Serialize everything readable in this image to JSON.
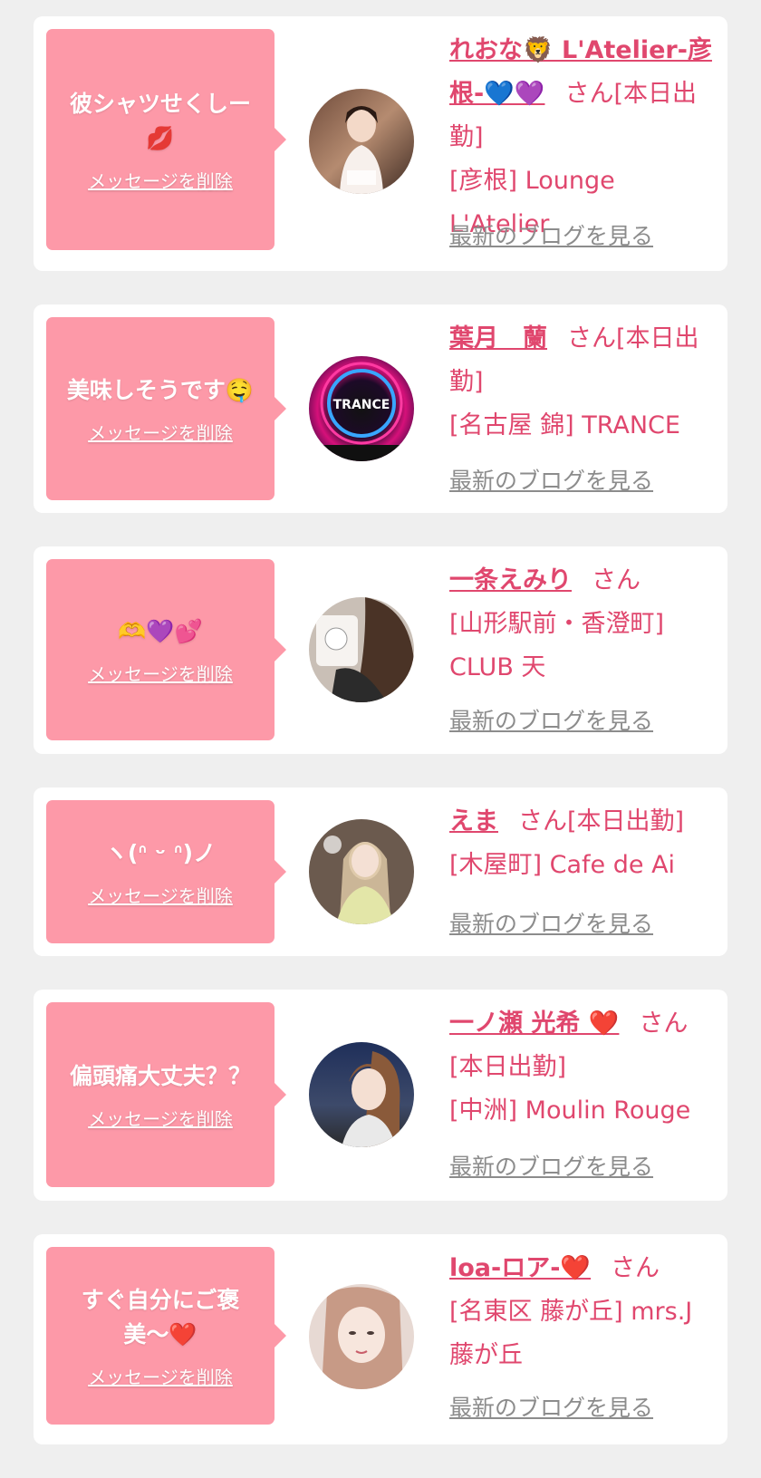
{
  "delete_label": "メッセージを削除",
  "blog_label": "最新のブログを見る",
  "colors": {
    "background": "#efefef",
    "card": "#ffffff",
    "bubble": "#fd99a8",
    "accent": "#e0476e",
    "link_gray": "#8c8c8c"
  },
  "cards": [
    {
      "message": "彼シャツせくしー💋",
      "name": "れおな🦁 L'Atelier-彦根-💙💜",
      "san_suffix": "さん[本日出勤]",
      "shop": "[彦根] Lounge L'Atelier"
    },
    {
      "message": "美味しそうです🤤",
      "name": "葉月　蘭",
      "san_suffix": "さん[本日出勤]",
      "shop": "[名古屋 錦] TRANCE"
    },
    {
      "message": "🫶💜💕",
      "name": "一条えみり",
      "san_suffix": "さん",
      "shop": "[山形駅前・香澄町] CLUB 天"
    },
    {
      "message": "ヽ(ᐢ ᵕ ᐢ)ノ",
      "name": "えま",
      "san_suffix": "さん[本日出勤]",
      "shop": "[木屋町] Cafe de Ai"
    },
    {
      "message": "偏頭痛大丈夫？？",
      "name": "一ノ瀬 光希 ❤️",
      "san_suffix": "さん[本日出勤]",
      "shop": "[中洲] Moulin Rouge"
    },
    {
      "message": "すぐ自分にご褒美〜❤️",
      "name": "loa-ロア-❤️",
      "san_suffix": "さん",
      "shop": "[名東区 藤が丘] mrs.J 藤が丘"
    }
  ]
}
